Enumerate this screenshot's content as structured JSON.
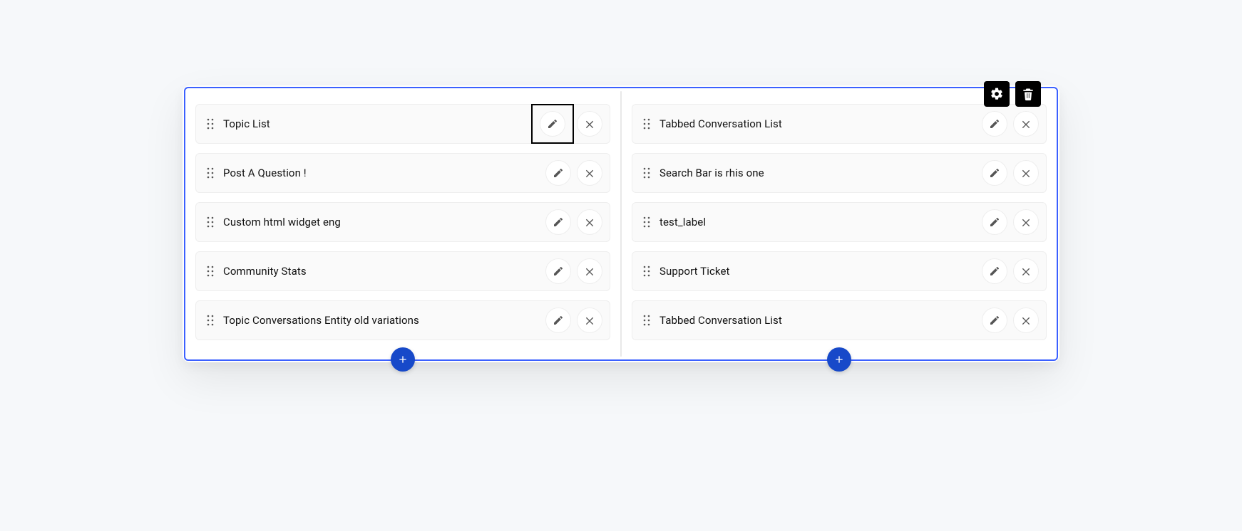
{
  "left_column": {
    "items": [
      {
        "label": "Topic List",
        "focused_edit": true
      },
      {
        "label": "Post A Question !"
      },
      {
        "label": "Custom html widget eng"
      },
      {
        "label": "Community Stats"
      },
      {
        "label": "Topic Conversations Entity old variations"
      }
    ]
  },
  "right_column": {
    "items": [
      {
        "label": "Tabbed Conversation List"
      },
      {
        "label": "Search Bar is rhis one"
      },
      {
        "label": "test_label"
      },
      {
        "label": "Support Ticket"
      },
      {
        "label": "Tabbed Conversation List"
      }
    ]
  },
  "icons": {
    "edit": "pencil",
    "remove": "close",
    "drag": "drag-handle",
    "add": "plus",
    "settings": "gear",
    "delete": "trash"
  },
  "colors": {
    "selection_blue": "#3b60ff",
    "primary_blue": "#1749c9",
    "row_bg": "#fafafa",
    "row_border": "#eeeeee"
  }
}
